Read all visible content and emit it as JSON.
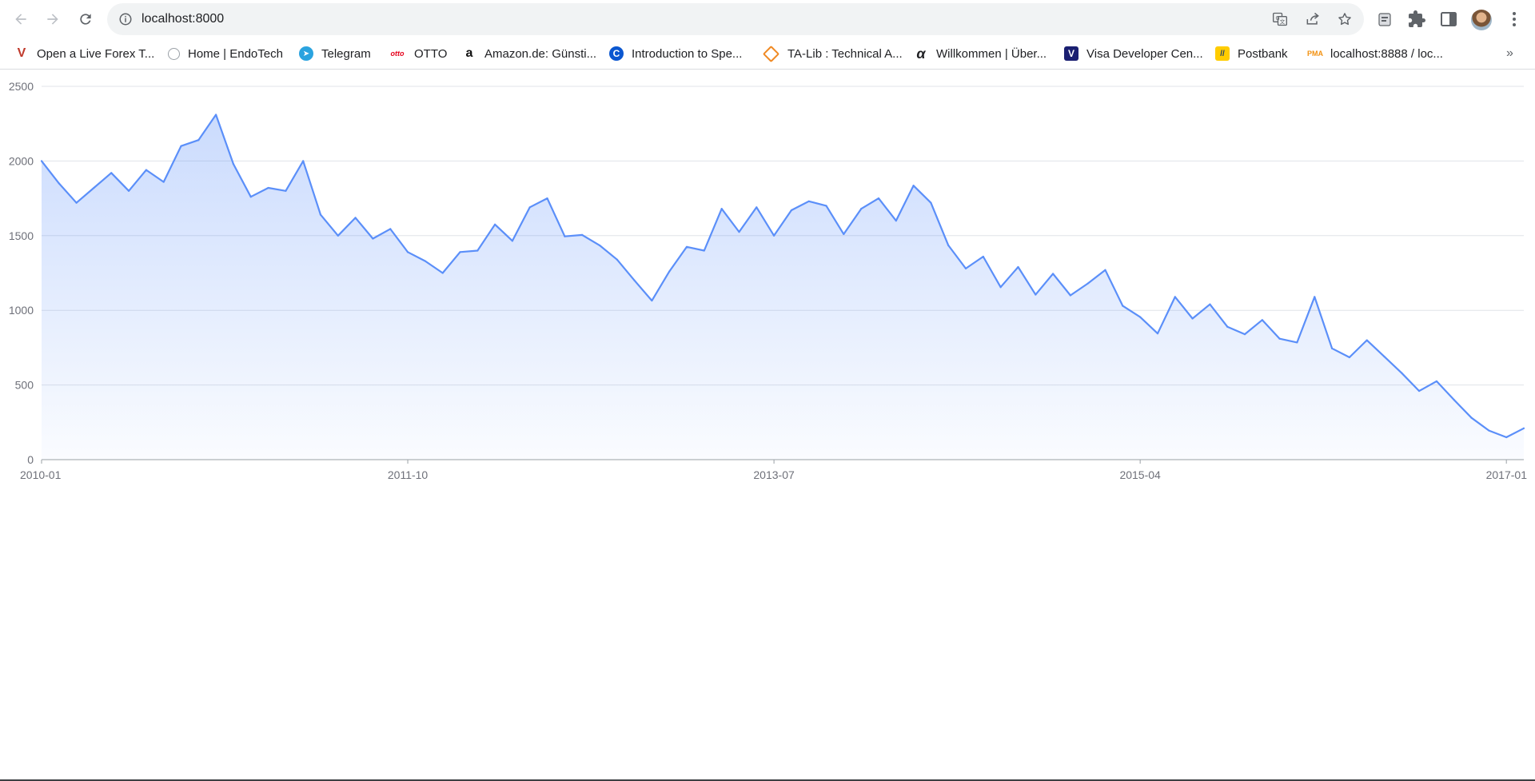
{
  "browser": {
    "url": "localhost:8000",
    "colors": {
      "accent": "#5b8ff9",
      "toolbar_bg": "#ffffff",
      "omnibox_bg": "#f1f3f4"
    },
    "icons": {
      "back": "arrow-left-icon",
      "forward": "arrow-right-icon",
      "reload": "reload-icon",
      "site_info": "info-icon",
      "translate": "translate-icon",
      "share": "share-icon",
      "bookmark": "star-icon",
      "extensions": "puzzle-icon",
      "side_panel": "side-panel-icon",
      "menu": "kebab-menu-icon",
      "profile": "avatar"
    }
  },
  "bookmarks": [
    {
      "label": "Open a Live Forex T...",
      "icon": "vantage-icon",
      "color": "#1a3d6e"
    },
    {
      "label": "Home | EndoTech",
      "icon": "endotech-icon",
      "color": "#9aa0a6"
    },
    {
      "label": "Telegram",
      "icon": "telegram-icon",
      "color": "#2aa3df"
    },
    {
      "label": "OTTO",
      "icon": "otto-icon",
      "color": "#e5001b"
    },
    {
      "label": "Amazon.de: Günsti...",
      "icon": "amazon-icon",
      "color": "#111111"
    },
    {
      "label": "Introduction to Spe...",
      "icon": "c-icon",
      "color": "#0b57d0"
    },
    {
      "label": "TA-Lib : Technical A...",
      "icon": "talib-icon",
      "color": "#f08a24"
    },
    {
      "label": "Willkommen | Über...",
      "icon": "alpha-icon",
      "color": "#202124"
    },
    {
      "label": "Visa Developer Cen...",
      "icon": "visa-icon",
      "color": "#1a1f71"
    },
    {
      "label": "Postbank",
      "icon": "postbank-icon",
      "color": "#ffcc00"
    },
    {
      "label": "localhost:8888 / loc...",
      "icon": "phpmyadmin-icon",
      "color": "#f29111"
    }
  ],
  "chart_data": {
    "type": "area",
    "x": [
      "2010-01",
      "2010-02",
      "2010-03",
      "2010-04",
      "2010-05",
      "2010-06",
      "2010-07",
      "2010-08",
      "2010-09",
      "2010-10",
      "2010-11",
      "2010-12",
      "2011-01",
      "2011-02",
      "2011-03",
      "2011-04",
      "2011-05",
      "2011-06",
      "2011-07",
      "2011-08",
      "2011-09",
      "2011-10",
      "2011-11",
      "2011-12",
      "2012-01",
      "2012-02",
      "2012-03",
      "2012-04",
      "2012-05",
      "2012-06",
      "2012-07",
      "2012-08",
      "2012-09",
      "2012-10",
      "2012-11",
      "2012-12",
      "2013-01",
      "2013-02",
      "2013-03",
      "2013-04",
      "2013-05",
      "2013-06",
      "2013-07",
      "2013-08",
      "2013-09",
      "2013-10",
      "2013-11",
      "2013-12",
      "2014-01",
      "2014-02",
      "2014-03",
      "2014-04",
      "2014-05",
      "2014-06",
      "2014-07",
      "2014-08",
      "2014-09",
      "2014-10",
      "2014-11",
      "2014-12",
      "2015-01",
      "2015-02",
      "2015-03",
      "2015-04",
      "2015-05",
      "2015-06",
      "2015-07",
      "2015-08",
      "2015-09",
      "2015-10",
      "2015-11",
      "2015-12",
      "2016-01",
      "2016-02",
      "2016-03",
      "2016-04",
      "2016-05",
      "2016-06",
      "2016-07",
      "2016-08",
      "2016-09",
      "2016-10",
      "2016-11",
      "2016-12",
      "2017-01",
      "2017-02"
    ],
    "y": [
      2000,
      1850,
      1720,
      1820,
      1920,
      1800,
      1940,
      1860,
      2100,
      2140,
      2310,
      1980,
      1760,
      1820,
      1800,
      2000,
      1640,
      1500,
      1620,
      1480,
      1545,
      1390,
      1330,
      1250,
      1390,
      1400,
      1575,
      1465,
      1690,
      1750,
      1495,
      1505,
      1435,
      1340,
      1200,
      1065,
      1260,
      1425,
      1400,
      1680,
      1525,
      1690,
      1500,
      1670,
      1730,
      1700,
      1510,
      1680,
      1750,
      1600,
      1835,
      1720,
      1435,
      1280,
      1360,
      1155,
      1290,
      1105,
      1245,
      1100,
      1180,
      1270,
      1030,
      955,
      845,
      1090,
      945,
      1040,
      890,
      840,
      935,
      810,
      785,
      1090,
      745,
      685,
      800,
      690,
      580,
      460,
      525,
      400,
      280,
      195,
      150,
      210
    ],
    "ylim": [
      0,
      2500
    ],
    "yticks": [
      "0",
      "500",
      "1000",
      "1500",
      "2000",
      "2500"
    ],
    "xticks": [
      "2010-01",
      "2011-10",
      "2013-07",
      "2015-04",
      "2017-01"
    ],
    "title": "",
    "xlabel": "",
    "ylabel": "",
    "grid": true,
    "line_color": "#5b8ff9"
  }
}
